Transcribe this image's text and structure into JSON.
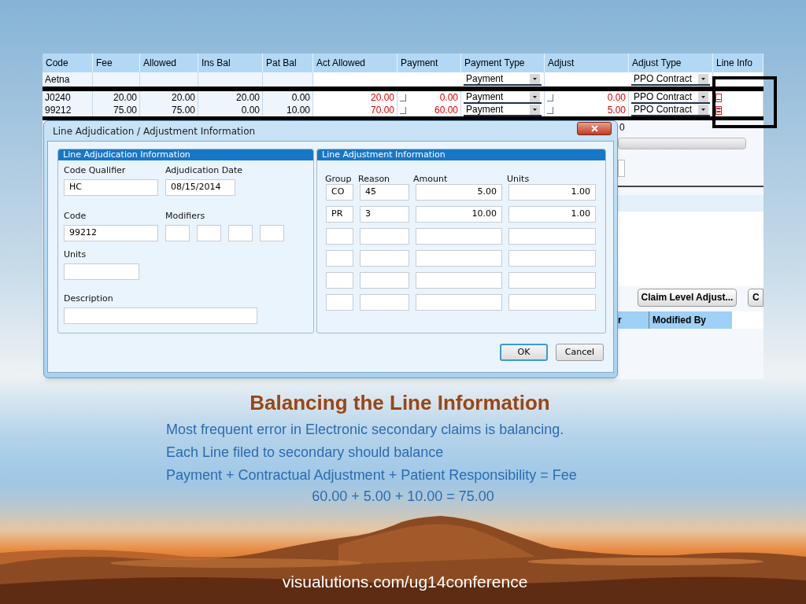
{
  "table": {
    "columns": [
      "Code",
      "Fee",
      "Allowed",
      "Ins Bal",
      "Pat Bal",
      "Act Allowed",
      "Payment",
      "Payment Type",
      "Adjust",
      "Adjust Type",
      "Line Info"
    ],
    "payer_row": {
      "code": "Aetna",
      "payment_type": "Payment",
      "adjust_type": "PPO Contract"
    },
    "rows": [
      {
        "code": "J0240",
        "fee": "20.00",
        "allowed": "20.00",
        "ins_bal": "20.00",
        "pat_bal": "0.00",
        "act_allowed": "20.00",
        "payment_checked": false,
        "payment": "0.00",
        "payment_type": "Payment",
        "adjust_checked": false,
        "adjust": "0.00",
        "adjust_type": "PPO Contract",
        "line_info": {
          "kind": "blank"
        }
      },
      {
        "code": "99212",
        "fee": "75.00",
        "allowed": "75.00",
        "ins_bal": "0.00",
        "pat_bal": "10.00",
        "act_allowed": "70.00",
        "payment_checked": false,
        "payment": "60.00",
        "payment_type": "Payment",
        "adjust_checked": false,
        "adjust": "5.00",
        "adjust_type": "PPO Contract",
        "line_info": {
          "kind": "filled"
        }
      }
    ]
  },
  "background": {
    "partial_cell": "0",
    "buttons": [
      "Claim Level Adjust...",
      "C"
    ],
    "columns": [
      "r",
      "Modified By"
    ]
  },
  "dialog": {
    "title": "Line Adjudication / Adjustment Information",
    "adjudication": {
      "title": "Line Adjudication Information",
      "code_qualifier": {
        "label": "Code Qualifier",
        "value": "HC"
      },
      "adjudication_date": {
        "label": "Adjudication Date",
        "value": "08/15/2014"
      },
      "code": {
        "label": "Code",
        "value": "99212"
      },
      "modifiers": {
        "label": "Modifiers"
      },
      "units": {
        "label": "Units"
      },
      "description": {
        "label": "Description"
      }
    },
    "adjustment": {
      "title": "Line Adjustment Information",
      "columns": [
        "Group",
        "Reason",
        "Amount",
        "Units"
      ],
      "rows": [
        {
          "group": "CO",
          "reason": "45",
          "amount": "5.00",
          "units": "1.00"
        },
        {
          "group": "PR",
          "reason": "3",
          "amount": "10.00",
          "units": "1.00"
        },
        {},
        {},
        {},
        {}
      ]
    },
    "buttons": [
      {
        "label": "OK",
        "default": true
      },
      {
        "label": "Cancel",
        "default": false
      }
    ]
  },
  "slide": {
    "title": "Balancing the Line Information",
    "lines": [
      "Most frequent error in Electronic secondary claims is balancing.",
      "Each Line filed to secondary should balance",
      "Payment + Contractual Adjustment + Patient Responsibility = Fee"
    ],
    "equation": "60.00 + 5.00 + 10.00 = 75.00",
    "footer": "visualutions.com/ug14conference"
  }
}
